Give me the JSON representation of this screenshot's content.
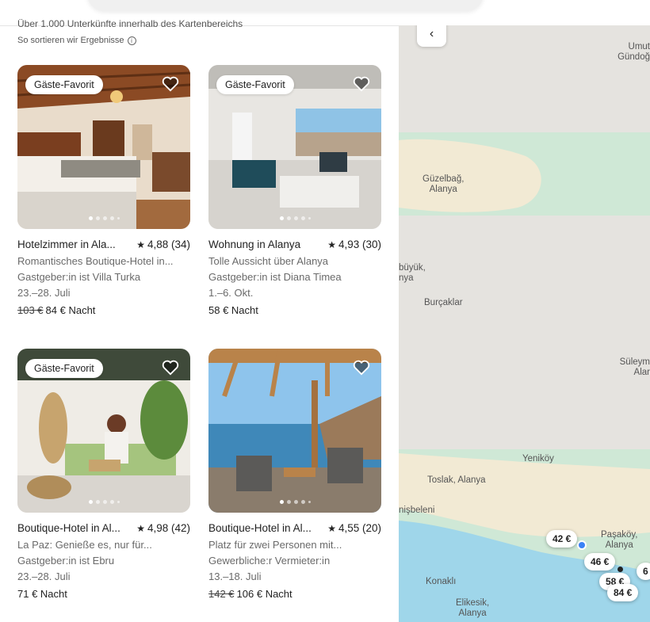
{
  "header": {
    "result_count": "Über 1.000 Unterkünfte innerhalb des Kartenbereichs",
    "sort_info": "So sortieren wir Ergebnisse"
  },
  "listings": [
    {
      "badge": "Gäste-Favorit",
      "title": "Hotelzimmer in Ala...",
      "rating": "4,88 (34)",
      "subtitle": "Romantisches Boutique-Hotel in...",
      "host": "Gastgeber:in ist Villa Turka",
      "dates": "23.–28. Juli",
      "old_price": "103 €",
      "price": "84 € Nacht"
    },
    {
      "badge": "Gäste-Favorit",
      "title": "Wohnung in Alanya",
      "rating": "4,93 (30)",
      "subtitle": "Tolle Aussicht über Alanya",
      "host": "Gastgeber:in ist Diana Timea",
      "dates": "1.–6. Okt.",
      "old_price": "",
      "price": "58 € Nacht"
    },
    {
      "badge": "Gäste-Favorit",
      "title": "Boutique-Hotel in Al...",
      "rating": "4,98 (42)",
      "subtitle": "La Paz: Genieße es, nur für...",
      "host": "Gastgeber:in ist Ebru",
      "dates": "23.–28. Juli",
      "old_price": "",
      "price": "71 € Nacht"
    },
    {
      "badge": "",
      "title": "Boutique-Hotel in Al...",
      "rating": "4,55 (20)",
      "subtitle": "Platz für zwei Personen mit...",
      "host": "Gewerbliche:r Vermieter:in",
      "dates": "13.–18. Juli",
      "old_price": "142 €",
      "price": "106 € Nacht"
    }
  ],
  "map": {
    "back_icon": "chevron-left-icon",
    "labels": {
      "umut": "Umut\nGündoğ",
      "guzelbag": "Güzelbağ,\nAlanya",
      "buyuk": "büyük,\nnya",
      "burcaklar": "Burçaklar",
      "suleym": "Süleym\nAlar",
      "yenikoy": "Yeniköy",
      "toslak": "Toslak, Alanya",
      "isbeleni": "nişbeleni",
      "pasakoy": "Paşaköy,\nAlanya",
      "konakli": "Konaklı",
      "elikesik": "Elikesik,\nAlanya"
    },
    "pins": {
      "p42": "42 €",
      "p46": "46 €",
      "p58": "58 €",
      "p84": "84 €",
      "p6": "6"
    }
  },
  "colors": {
    "map_land": "#e5e3df",
    "map_green": "#cfe8d6",
    "map_sand": "#f2ead4",
    "map_sea": "#9fd6ea"
  }
}
